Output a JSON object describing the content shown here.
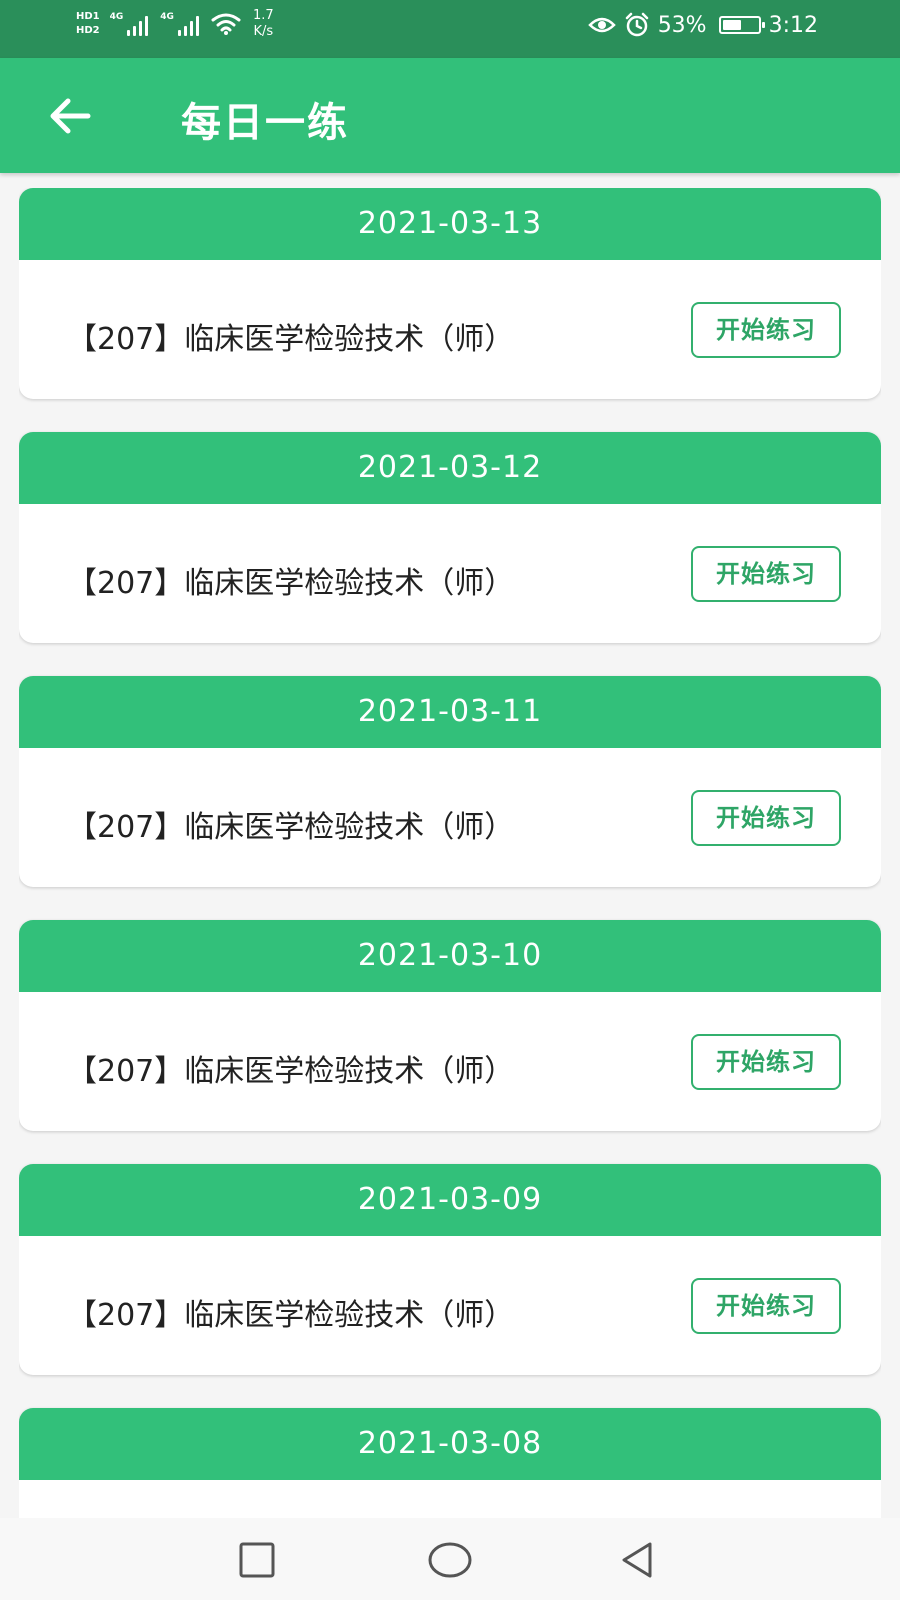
{
  "status_bar": {
    "hd_labels": [
      "HD1",
      "HD2"
    ],
    "network_tags": [
      "4G",
      "4G"
    ],
    "net_speed_value": "1.7",
    "net_speed_unit": "K/s",
    "battery_percent": "53%",
    "battery_level": 0.53,
    "time": "3:12",
    "icons": [
      "eye-icon",
      "alarm-icon",
      "wifi-icon",
      "battery-icon"
    ],
    "color": "#2a8f5a"
  },
  "app_bar": {
    "title": "每日一练",
    "back_icon": "arrow-left-icon",
    "color": "#32c07a"
  },
  "practice_items": [
    {
      "date": "2021-03-13",
      "title": "【207】临床医学检验技术（师）",
      "button": "开始练习"
    },
    {
      "date": "2021-03-12",
      "title": "【207】临床医学检验技术（师）",
      "button": "开始练习"
    },
    {
      "date": "2021-03-11",
      "title": "【207】临床医学检验技术（师）",
      "button": "开始练习"
    },
    {
      "date": "2021-03-10",
      "title": "【207】临床医学检验技术（师）",
      "button": "开始练习"
    },
    {
      "date": "2021-03-09",
      "title": "【207】临床医学检验技术（师）",
      "button": "开始练习"
    },
    {
      "date": "2021-03-08",
      "title": "",
      "button": ""
    }
  ],
  "nav_bar": {
    "icons": [
      "square-recents-icon",
      "circle-home-icon",
      "triangle-back-icon"
    ]
  }
}
